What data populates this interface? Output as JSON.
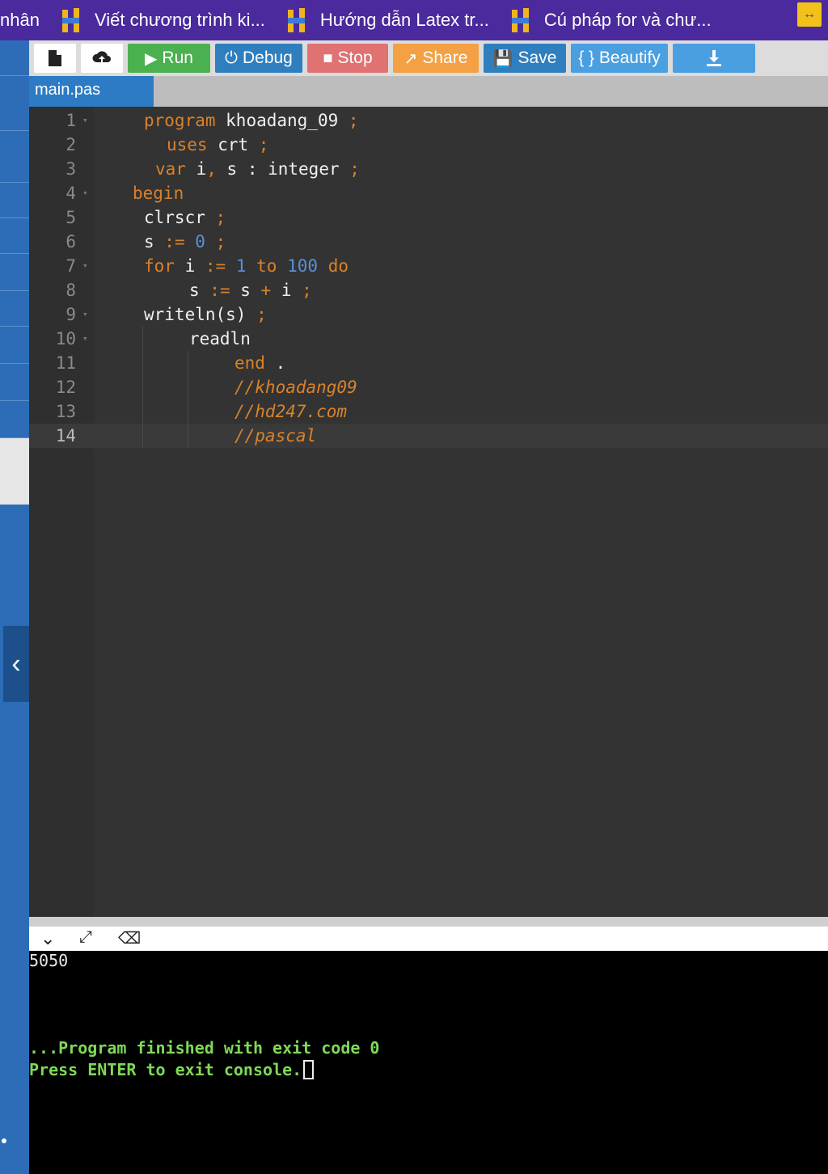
{
  "tabs": [
    {
      "label": "nhân"
    },
    {
      "label": "Viết chương trình ki..."
    },
    {
      "label": "Hướng dẫn Latex tr..."
    },
    {
      "label": "Cú pháp for và chư..."
    }
  ],
  "toolbar": {
    "run": "Run",
    "debug": "Debug",
    "stop": "Stop",
    "share": "Share",
    "save": "Save",
    "beautify": "{ } Beautify"
  },
  "file_tab": "main.pas",
  "editor": {
    "line_numbers": [
      "1",
      "2",
      "3",
      "4",
      "5",
      "6",
      "7",
      "8",
      "9",
      "10",
      "11",
      "12",
      "13",
      "14"
    ],
    "active_line": 14
  },
  "console": {
    "output": "5050",
    "finished": "...Program finished with exit code 0",
    "press_enter": "Press ENTER to exit console."
  },
  "colors": {
    "tabbar": "#4a2a9c",
    "editor_bg": "#333333",
    "keyword": "#d9822b",
    "number": "#5a8fd8",
    "console_message": "#7ed957"
  }
}
